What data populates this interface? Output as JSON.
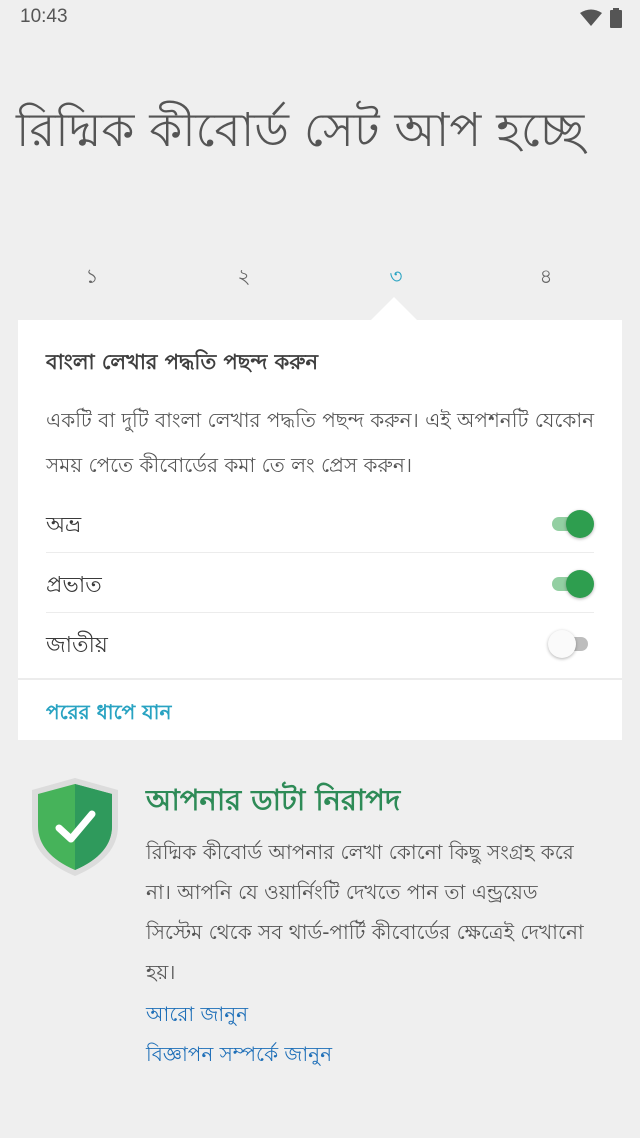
{
  "status_bar": {
    "time": "10:43",
    "icons": [
      "wifi-icon",
      "battery-icon"
    ]
  },
  "page": {
    "title": "রিদ্মিক কীবোর্ড সেট আপ হচ্ছে"
  },
  "steps": {
    "items": [
      "১",
      "২",
      "৩",
      "৪"
    ],
    "active_index": 2
  },
  "card": {
    "heading": "বাংলা লেখার পদ্ধতি পছন্দ করুন",
    "description": "একটি বা দুটি বাংলা লেখার পদ্ধতি পছন্দ করুন। এই অপশনটি যেকোন সময় পেতে কীবোর্ডের কমা তে লং প্রেস করুন।",
    "options": [
      {
        "label": "অভ্র",
        "enabled": true
      },
      {
        "label": "প্রভাত",
        "enabled": true
      },
      {
        "label": "জাতীয়",
        "enabled": false
      }
    ],
    "next_label": "পরের ধাপে যান"
  },
  "safety": {
    "title": "আপনার ডাটা নিরাপদ",
    "description": "রিদ্মিক কীবোর্ড আপনার লেখা কোনো কিছু সংগ্রহ করে না। আপনি যে ওয়ার্নিংটি দেখতে পান তা এন্ড্রয়েড সিস্টেম থেকে সব থার্ড-পার্টি কীবোর্ডের ক্ষেত্রেই দেখানো হয়।",
    "learn_more": "আরো জানুন",
    "ads_info": "বিজ্ঞাপন সম্পর্কে জানুন"
  },
  "colors": {
    "accent": "#29a3c2",
    "toggle_on": "#2e9e4f",
    "safe_green": "#2e8b57",
    "link_blue": "#1e6fb8"
  }
}
